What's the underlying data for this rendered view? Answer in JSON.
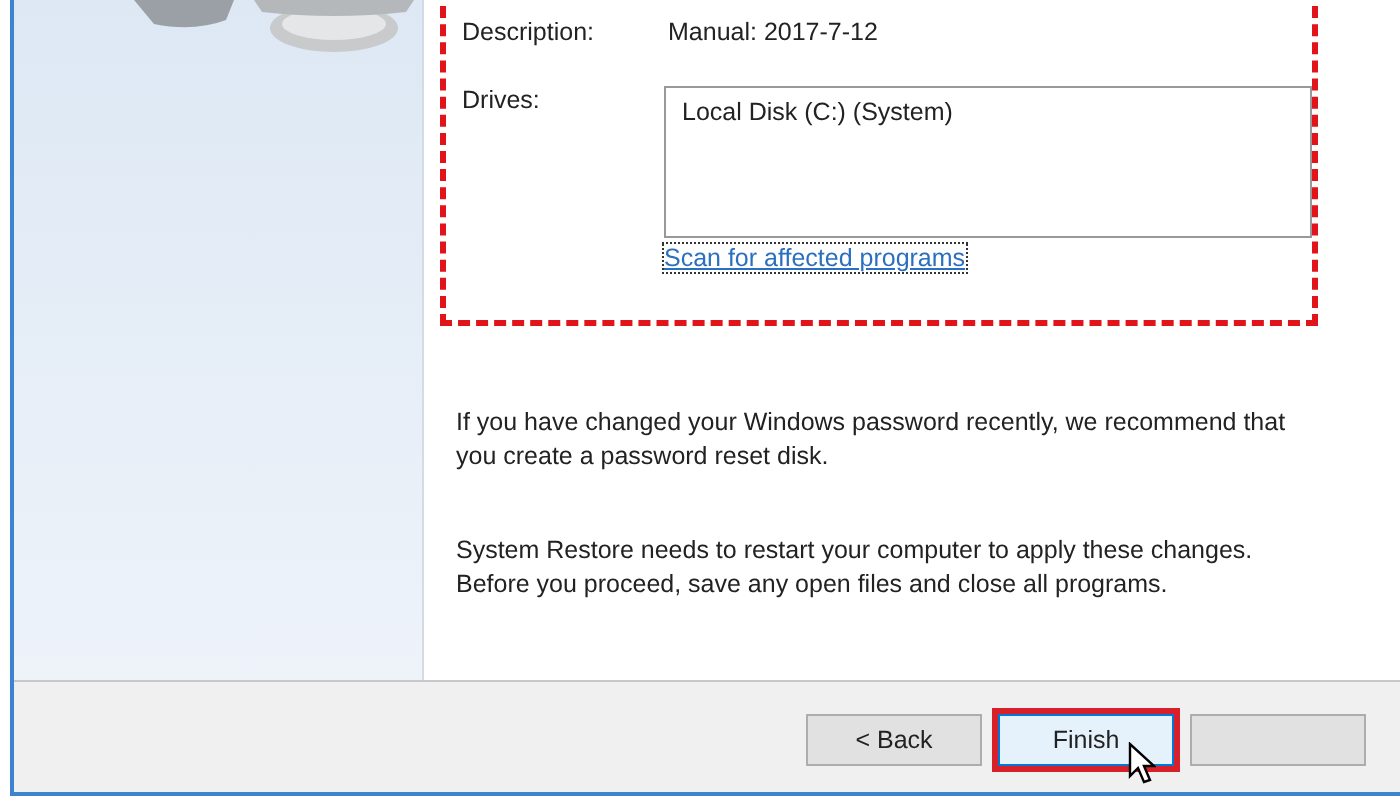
{
  "details": {
    "rows": [
      {
        "label": "Description:",
        "value": "Manual: 2017-7-12"
      },
      {
        "label": "Drives:",
        "list": [
          "Local Disk (C:) (System)"
        ]
      }
    ],
    "link": "Scan for affected programs",
    "annotated": true
  },
  "messages": [
    "If you have changed your Windows password recently, we recommend that you create a password reset disk.",
    "System Restore needs to restart your computer to apply these changes. Before you proceed, save any open files and close all programs."
  ],
  "buttons": [
    {
      "label": "< Back",
      "hovered": false,
      "annotated": false
    },
    {
      "label": "Finish",
      "hovered": true,
      "annotated": true
    },
    {
      "hovered": false,
      "annotated": false
    }
  ]
}
